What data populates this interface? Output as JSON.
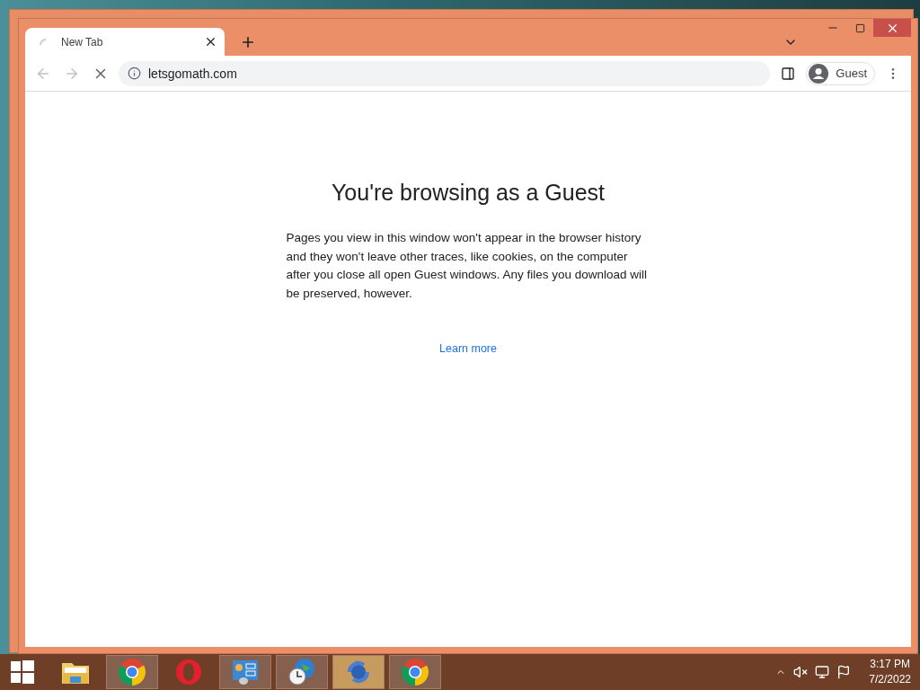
{
  "browser": {
    "tabs": [
      {
        "label": "New Tab",
        "selected": true,
        "loading": true
      }
    ],
    "loading": true,
    "address": "letsgomath.com",
    "profile": "Guest"
  },
  "page": {
    "title": "You're browsing as a Guest",
    "body": "Pages you view in this window won't appear in the browser history and they won't leave other traces, like cookies, on the computer after you close all open Guest windows. Any files you download will be preserved, however.",
    "link": "Learn more"
  },
  "taskbar": {
    "items": [
      {
        "kind": "explorer",
        "running": false,
        "selected": false
      },
      {
        "kind": "chrome",
        "running": true,
        "selected": false
      },
      {
        "kind": "opera",
        "running": false,
        "selected": false
      },
      {
        "kind": "panel",
        "running": true,
        "selected": false
      },
      {
        "kind": "globe",
        "running": true,
        "selected": false
      },
      {
        "kind": "sync",
        "running": true,
        "selected": true
      },
      {
        "kind": "chrome",
        "running": true,
        "selected": false
      }
    ],
    "clock": {
      "time": "3:17 PM",
      "date": "7/2/2022"
    }
  }
}
